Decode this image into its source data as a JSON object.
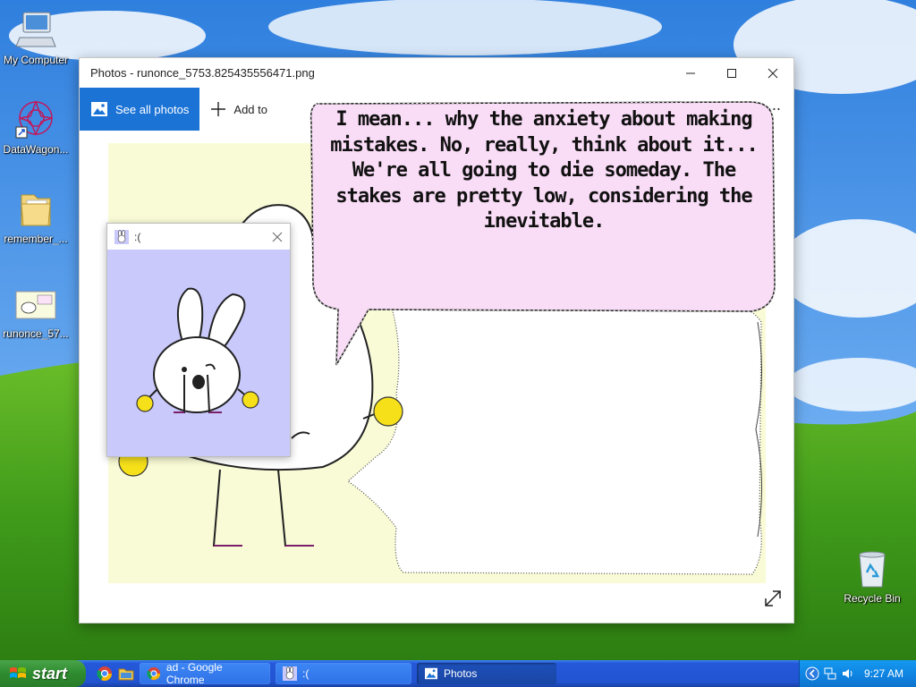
{
  "desktop": {
    "icons": [
      {
        "label": "My Computer",
        "icon": "computer-icon"
      },
      {
        "label": "DataWagon...",
        "icon": "datawagon-icon"
      },
      {
        "label": "remember_...",
        "icon": "folder-icon"
      },
      {
        "label": "runonce_57...",
        "icon": "image-file-icon"
      },
      {
        "label": "Recycle Bin",
        "icon": "recycle-bin-icon"
      }
    ]
  },
  "photos_window": {
    "title": "Photos - runonce_5753.825435556471.png",
    "toolbar": {
      "see_all_label": "See all photos",
      "add_to_label": "Add to",
      "more_label": "..."
    },
    "speech_bubble": {
      "lines": [
        "I mean... why the anxiety about making",
        "mistakes. No, really, think about it...",
        "We're all going to die someday. The",
        "stakes are pretty low, considering the",
        "inevitable."
      ]
    }
  },
  "sad_window": {
    "title": ":("
  },
  "taskbar": {
    "start_label": "start",
    "tasks": [
      {
        "label": "ad - Google Chrome",
        "icon": "chrome-icon",
        "active": false
      },
      {
        "label": ":(",
        "icon": "bunny-app-icon",
        "active": false
      },
      {
        "label": "Photos",
        "icon": "photos-icon",
        "active": true
      }
    ],
    "clock": "9:27 AM"
  },
  "colors": {
    "accent": "#1b73d6",
    "bubble_fill": "#f9dcf6",
    "canvas_bg": "#f9fbd6",
    "sad_bg": "#c9c9fb",
    "bunny_yellow": "#f5e01a"
  }
}
